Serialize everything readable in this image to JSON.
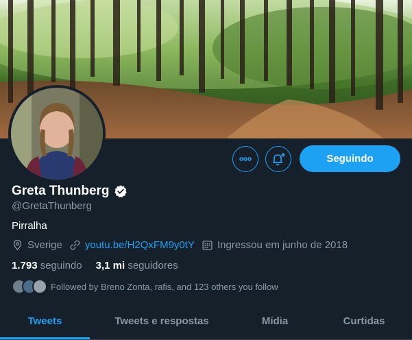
{
  "profile": {
    "name": "Greta Thunberg",
    "handle": "@GretaThunberg",
    "bio": "Pirralha",
    "location": "Sverige",
    "website": "youtu.be/H2QxFM9y0tY",
    "joined": "Ingressou em junho de 2018",
    "following_count": "1.793",
    "following_label": "seguindo",
    "followers_count": "3,1 mi",
    "followers_label": "seguidores",
    "followed_by": "Followed by Breno Zonta, rafis, and 123 others you follow"
  },
  "actions": {
    "follow_label": "Seguindo",
    "more_icon": "more-horizontal-icon",
    "notify_icon": "bell-plus-icon"
  },
  "tabs": [
    {
      "label": "Tweets",
      "active": true
    },
    {
      "label": "Tweets e respostas",
      "active": false
    },
    {
      "label": "Mídia",
      "active": false
    },
    {
      "label": "Curtidas",
      "active": false
    }
  ],
  "colors": {
    "background": "#15202b",
    "accent": "#1da1f2",
    "secondary_text": "#8899a6",
    "divider": "#38444d"
  }
}
